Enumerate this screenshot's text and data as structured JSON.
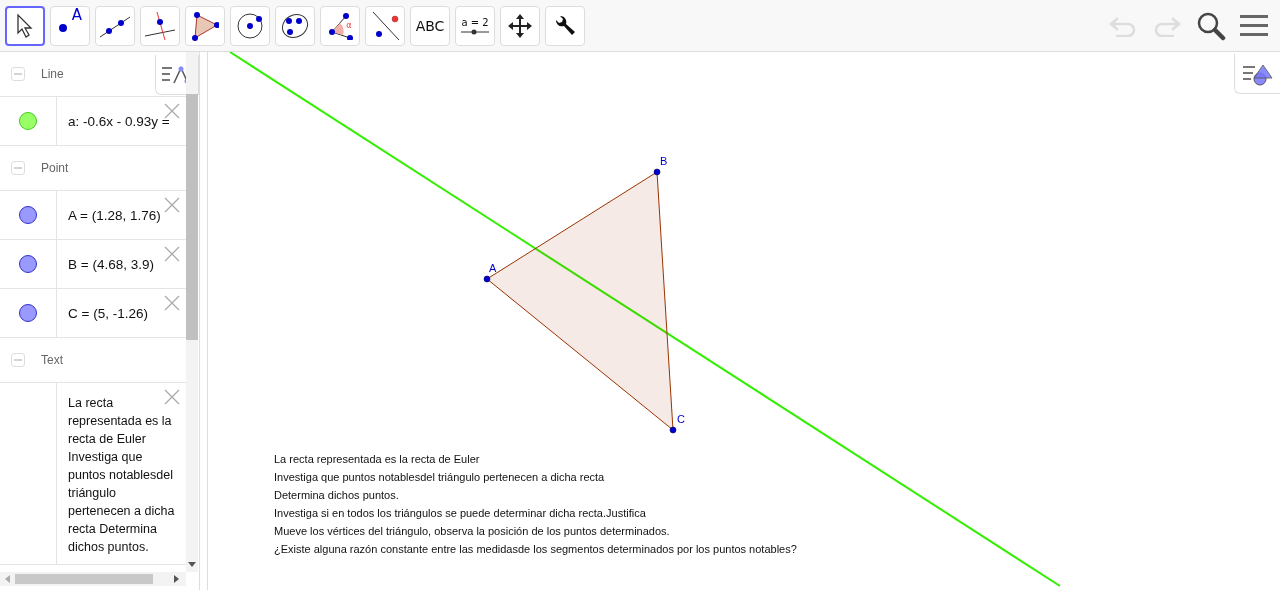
{
  "toolbar": {
    "tools": [
      {
        "kind": "move",
        "selected": true
      },
      {
        "kind": "point",
        "label": "A",
        "selected": false
      },
      {
        "kind": "line",
        "selected": false
      },
      {
        "kind": "perpendicular",
        "selected": false
      },
      {
        "kind": "polygon",
        "selected": false
      },
      {
        "kind": "circle",
        "selected": false
      },
      {
        "kind": "conic",
        "selected": false
      },
      {
        "kind": "angle",
        "label": "α",
        "selected": false
      },
      {
        "kind": "reflect",
        "selected": false
      },
      {
        "kind": "text",
        "label": "ABC",
        "selected": false
      },
      {
        "kind": "slider",
        "label": "a = 2",
        "selected": false
      },
      {
        "kind": "pan",
        "selected": false
      },
      {
        "kind": "tools",
        "selected": false
      }
    ],
    "undo": {
      "disabled": true
    },
    "redo": {
      "disabled": true
    }
  },
  "algebra": {
    "sections": [
      {
        "title": "Line",
        "expanded": true,
        "items": [
          {
            "kind": "object",
            "text": "a: -0.6x - 0.93y =",
            "color": "#99ff66"
          }
        ]
      },
      {
        "title": "Point",
        "expanded": true,
        "items": [
          {
            "kind": "object",
            "text": "A = (1.28, 1.76)",
            "color": "#9999ff"
          },
          {
            "kind": "object",
            "text": "B = (4.68, 3.9)",
            "color": "#9999ff"
          },
          {
            "kind": "object",
            "text": "C = (5, -1.26)",
            "color": "#9999ff"
          }
        ]
      },
      {
        "title": "Text",
        "expanded": true,
        "items": [
          {
            "kind": "text",
            "text": "La recta representada es la recta de Euler Investiga que puntos notablesdel triángulo pertenecen a dicha recta Determina dichos puntos."
          }
        ]
      }
    ]
  },
  "graphics": {
    "points": [
      {
        "label": "A"
      },
      {
        "label": "B"
      },
      {
        "label": "C"
      }
    ],
    "text_lines": [
      "La recta representada es la recta de Euler",
      "Investiga que puntos notablesdel triángulo pertenecen a dicha recta",
      "Determina dichos puntos.",
      "Investiga si en todos los triángulos se puede determinar dicha recta.Justifica",
      "Mueve los vértices del triángulo, observa la posición de los puntos determinados.",
      "¿Existe alguna razón constante entre las medidasde los segmentos determinados por los puntos notables?"
    ]
  }
}
